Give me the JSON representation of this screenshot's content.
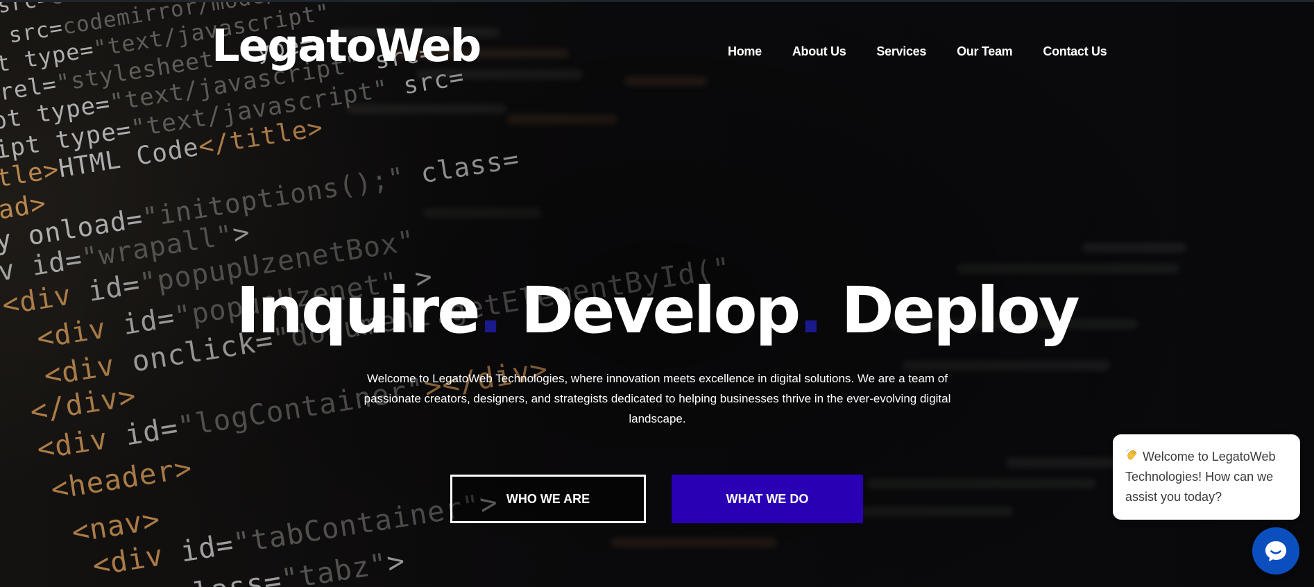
{
  "brand": {
    "logo": "LegatoWeb"
  },
  "nav": {
    "items": [
      "Home",
      "About Us",
      "Services",
      "Our Team",
      "Contact Us"
    ]
  },
  "hero": {
    "words": [
      "Inquire",
      "Develop",
      "Deploy"
    ],
    "separator": ".",
    "description": "Welcome to LegatoWeb Technologies, where innovation meets excellence in digital solutions. We are a team of passionate creators, designers, and strategists dedicated to helping businesses thrive in the ever-evolving digital landscape.",
    "primary_button": "WHO WE ARE",
    "secondary_button": "WHAT WE DO"
  },
  "chat": {
    "greeting": "Welcome to LegatoWeb Technologies! How can we assist you today?",
    "greeting_icon": "waving-hand-icon",
    "launcher_icon": "chat-bubble-icon"
  },
  "colors": {
    "accent_button": "#2a00b5",
    "title_dot": "#1a1a8c",
    "chat_launcher": "#0b4fbf"
  },
  "background_code": {
    "lines": [
      [
        {
          "c": "t",
          "v": "src="
        },
        {
          "c": "s",
          "v": "codemirror/lib/codemirror.js"
        }
      ],
      [
        {
          "c": "t",
          "v": " src="
        },
        {
          "c": "s",
          "v": "codemirror/mode/xml.js"
        }
      ],
      [
        {
          "c": "t",
          "v": "t type="
        },
        {
          "c": "s",
          "v": "\"text/javascript\""
        }
      ],
      [
        {
          "c": "t",
          "v": "rel="
        },
        {
          "c": "s",
          "v": "\"stylesheet\""
        },
        {
          "c": "t",
          "v": "  type="
        }
      ],
      [
        {
          "c": "t",
          "v": "pt type="
        },
        {
          "c": "s",
          "v": "\"text/javascript\""
        },
        {
          "c": "t",
          "v": "  src="
        }
      ],
      [
        {
          "c": "t",
          "v": "ipt type="
        },
        {
          "c": "s",
          "v": "\"text/javascript\""
        },
        {
          "c": "t",
          "v": "  src="
        }
      ],
      [
        {
          "c": "k",
          "v": "tle>"
        },
        {
          "c": "t",
          "v": "HTML Code"
        },
        {
          "c": "k",
          "v": "</title>"
        }
      ],
      [
        {
          "c": "k",
          "v": "ad>"
        }
      ],
      [
        {
          "c": "t",
          "v": "y onload="
        },
        {
          "c": "s",
          "v": "\"initoptions();\""
        },
        {
          "c": "t",
          "v": "  class="
        }
      ],
      [
        {
          "c": "t",
          "v": "v id="
        },
        {
          "c": "s",
          "v": "\"wrapall\""
        },
        {
          "c": "t",
          "v": ">"
        }
      ],
      [
        {
          "c": "k",
          "v": "<div"
        },
        {
          "c": "t",
          "v": " id="
        },
        {
          "c": "s",
          "v": "\"popupUzenetBox\""
        }
      ],
      [
        {
          "c": "k",
          "v": "<div"
        },
        {
          "c": "t",
          "v": " id="
        },
        {
          "c": "s",
          "v": "\"popupUzenet\""
        },
        {
          "c": "t",
          "v": " >"
        }
      ],
      [
        {
          "c": "k",
          "v": "<div"
        },
        {
          "c": "t",
          "v": " onclick="
        },
        {
          "c": "s",
          "v": "\"document.getElementById(\""
        }
      ],
      [
        {
          "c": "k",
          "v": "</div>"
        }
      ],
      [
        {
          "c": "k",
          "v": "<div"
        },
        {
          "c": "t",
          "v": " id="
        },
        {
          "c": "s",
          "v": "\"logContainer\""
        },
        {
          "c": "k",
          "v": "></div>"
        }
      ],
      [
        {
          "c": "k",
          "v": "<header>"
        }
      ],
      [
        {
          "c": "k",
          "v": "<nav>"
        }
      ],
      [
        {
          "c": "k",
          "v": "<div"
        },
        {
          "c": "t",
          "v": " id="
        },
        {
          "c": "s",
          "v": "\"tabContainer\""
        },
        {
          "c": "t",
          "v": ">"
        }
      ],
      [
        {
          "c": "t",
          "v": "class="
        },
        {
          "c": "s",
          "v": "\"tabz\""
        },
        {
          "c": "t",
          "v": ">"
        }
      ]
    ]
  }
}
